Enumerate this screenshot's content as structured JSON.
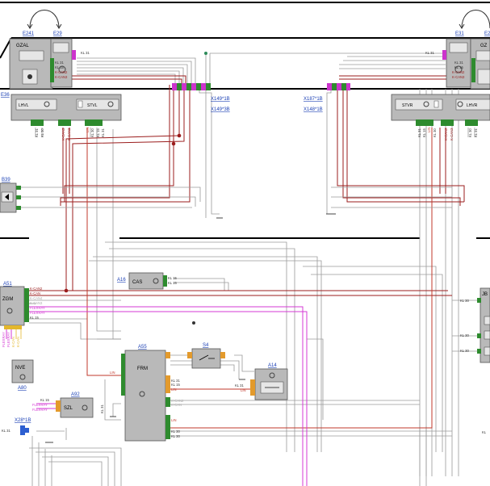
{
  "colors": {
    "kcan": "#9b1d1d",
    "kcan2": "#bfbfbf",
    "flexray": "#d43ad4",
    "lin": "#c0392b",
    "kl": "#9a9a9a",
    "connector_green": "#2e8b2e",
    "connector_magenta": "#cc33cc",
    "connector_orange": "#e39a2c",
    "connector_blue": "#2d5fd1",
    "component": "#b9b9b9"
  },
  "components": {
    "e241": {
      "ref": "E241",
      "name": "GZAL"
    },
    "e29": {
      "ref": "E29"
    },
    "e31": {
      "ref": "E31"
    },
    "gzar_partial": {
      "name": "GZ"
    },
    "e36": {
      "ref": "E36"
    },
    "lhvl": {
      "name": "LHVL"
    },
    "stvl": {
      "name": "STVL"
    },
    "stvr": {
      "name": "STVR"
    },
    "lhvr": {
      "name": "LHVR"
    },
    "b39": {
      "ref": "B39"
    },
    "a51": {
      "ref": "A51",
      "name": "ZGM"
    },
    "a16": {
      "ref": "A16",
      "name": "CAS"
    },
    "a55": {
      "ref": "A55",
      "name": "FRM"
    },
    "s4": {
      "ref": "S4"
    },
    "a14": {
      "ref": "A14"
    },
    "nve": {
      "name": "NVE",
      "ref": "A80"
    },
    "a92": {
      "ref": "A92",
      "name": "SZL"
    },
    "jb": {
      "name": "JB"
    }
  },
  "connectors": {
    "x149_1b": "X149*1B",
    "x149_3b": "X149*3B",
    "x187_1b": "X187*1B",
    "x148_1b": "X148*1B",
    "x28_1b": "X28*1B"
  },
  "pins": {
    "kl31": "KL 31",
    "kl30": "KL 30",
    "kl15": "KL 15",
    "kcan": "K-CAN",
    "kcan2": "K-CAN2",
    "kcan3": "K-CAN3",
    "kcan4": "K-CAN4",
    "lin": "LIN",
    "flexray": "FLEXRAY"
  }
}
